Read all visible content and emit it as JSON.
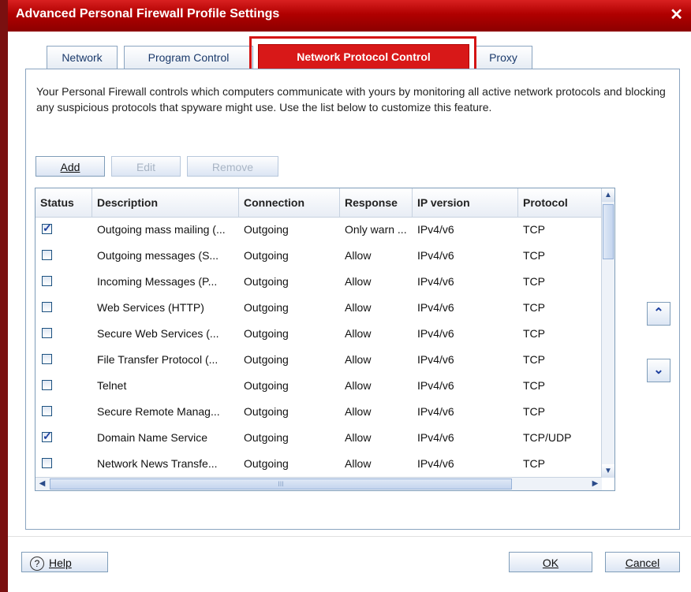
{
  "window": {
    "title": "Advanced Personal Firewall Profile Settings",
    "close_glyph": "✕"
  },
  "tabs": [
    {
      "label": "Network"
    },
    {
      "label": "Program Control"
    },
    {
      "label": "Network Protocol Control",
      "active": true
    },
    {
      "label": "Proxy"
    }
  ],
  "description": "Your Personal Firewall controls which computers communicate with yours by monitoring all active network protocols and blocking any suspicious protocols that spyware might use. Use the list below to customize this feature.",
  "toolbar": {
    "add": "Add",
    "edit": "Edit",
    "remove": "Remove"
  },
  "table": {
    "columns": [
      "Status",
      "Description",
      "Connection",
      "Response",
      "IP version",
      "Protocol"
    ],
    "rows": [
      {
        "checked": true,
        "description": "Outgoing mass mailing (...",
        "connection": "Outgoing",
        "response": "Only warn ...",
        "ip": "IPv4/v6",
        "protocol": "TCP"
      },
      {
        "checked": false,
        "description": "Outgoing messages (S...",
        "connection": "Outgoing",
        "response": "Allow",
        "ip": "IPv4/v6",
        "protocol": "TCP"
      },
      {
        "checked": false,
        "description": "Incoming Messages (P...",
        "connection": "Outgoing",
        "response": "Allow",
        "ip": "IPv4/v6",
        "protocol": "TCP"
      },
      {
        "checked": false,
        "description": "Web Services (HTTP)",
        "connection": "Outgoing",
        "response": "Allow",
        "ip": "IPv4/v6",
        "protocol": "TCP"
      },
      {
        "checked": false,
        "description": "Secure Web Services (...",
        "connection": "Outgoing",
        "response": "Allow",
        "ip": "IPv4/v6",
        "protocol": "TCP"
      },
      {
        "checked": false,
        "description": "File Transfer Protocol (...",
        "connection": "Outgoing",
        "response": "Allow",
        "ip": "IPv4/v6",
        "protocol": "TCP"
      },
      {
        "checked": false,
        "description": "Telnet",
        "connection": "Outgoing",
        "response": "Allow",
        "ip": "IPv4/v6",
        "protocol": "TCP"
      },
      {
        "checked": false,
        "description": "Secure Remote Manag...",
        "connection": "Outgoing",
        "response": "Allow",
        "ip": "IPv4/v6",
        "protocol": "TCP"
      },
      {
        "checked": true,
        "description": "Domain Name Service",
        "connection": "Outgoing",
        "response": "Allow",
        "ip": "IPv4/v6",
        "protocol": "TCP/UDP"
      },
      {
        "checked": false,
        "description": "Network News Transfe...",
        "connection": "Outgoing",
        "response": "Allow",
        "ip": "IPv4/v6",
        "protocol": "TCP"
      }
    ]
  },
  "scroll": {
    "hscroll_grip": "III"
  },
  "footer": {
    "help": "Help",
    "ok": "OK",
    "cancel": "Cancel"
  },
  "colors": {
    "accent": "#d81818",
    "link": "#1b3a6b"
  }
}
